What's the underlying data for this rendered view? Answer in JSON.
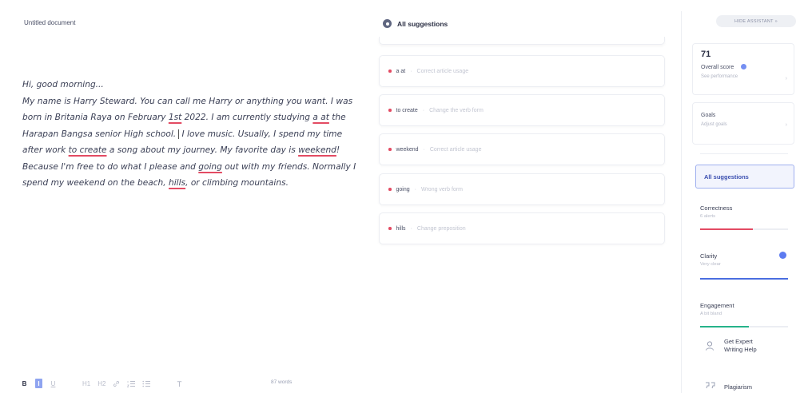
{
  "document": {
    "title": "Untitled document",
    "greeting": "Hi, good morning...",
    "paragraph": {
      "s1": "My name is Harry Steward. You can call me Harry or anything you want. I was born in Britania Raya on February ",
      "e1": "1st",
      "s2": " 2022. I am currently studying ",
      "e2": "a at",
      "s3": " the Harapan Bangsa senior High school.",
      "s4": " I love music. Usually, I spend my time after work ",
      "e3": "to create",
      "s5": " a song about my journey. My favorite day is ",
      "e4": "weekend",
      "s6": "! Because I'm free to do what I please and ",
      "e5": "going",
      "s7": " out with my friends. Normally I spend my weekend on the beach, ",
      "e6": "hills",
      "s8": ", or climbing mountains."
    }
  },
  "toolbar": {
    "bold": "B",
    "italic": "I",
    "underline": "U",
    "h1": "H1",
    "h2": "H2",
    "link": "link-icon",
    "ordered_list": "ordered-list-icon",
    "bullet_list": "bullet-list-icon",
    "clear": "clear-format-icon",
    "word_count": "87 words"
  },
  "suggestions": {
    "title": "All suggestions",
    "items": [
      {
        "word": "a at",
        "desc": "Correct article usage"
      },
      {
        "word": "to create",
        "desc": "Change the verb form"
      },
      {
        "word": "weekend",
        "desc": "Correct article usage"
      },
      {
        "word": "going",
        "desc": "Wrong verb form"
      },
      {
        "word": "hills",
        "desc": "Change preposition"
      }
    ]
  },
  "sidebar": {
    "hide_assistant": "HIDE ASSISTANT",
    "score": {
      "value": "71",
      "label": "Overall score",
      "sub": "See performance"
    },
    "goals": {
      "label": "Goals",
      "sub": "Adjust goals"
    },
    "all_suggestions": "All suggestions",
    "categories": [
      {
        "name": "Correctness",
        "sub": "6 alerts",
        "color": "#e34b63",
        "fill": 0.6
      },
      {
        "name": "Clarity",
        "sub": "Very clear",
        "color": "#4a6ee0",
        "fill": 1.0
      },
      {
        "name": "Engagement",
        "sub": "A bit bland",
        "color": "#26b38a",
        "fill": 0.55
      }
    ],
    "expert_help": {
      "line1": "Get Expert",
      "line2": "Writing Help"
    },
    "plagiarism": "Plagiarism"
  },
  "colors": {
    "error_underline": "#e34b63",
    "accent": "#5d7bf0"
  }
}
